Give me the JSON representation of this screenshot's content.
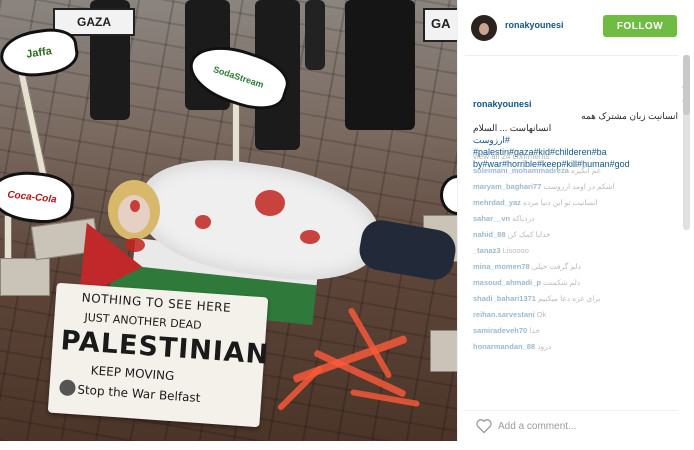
{
  "post": {
    "username": "ronakyounesi",
    "follow_label": "FOLLOW",
    "watermark_text": "mashreghnews.ir",
    "caption": {
      "user": "ronakyounesi",
      "text_fa_1": "انسانیت زبان مشترک همه",
      "text_fa_2": "انسانهاست ... السلام",
      "hashtags_line1": "#ارزوست",
      "hashtags_line2": "#palestin#gaza#kid#childeren#ba",
      "hashtags_line3": "by#war#horrible#keep#kill#human#god"
    },
    "view_all": "view all 24 comments",
    "comments": [
      {
        "user": "soleimani_mohammadreza",
        "text": "غم انگیزه"
      },
      {
        "user": "maryam_baghari77",
        "text": "اشکم در اومد ارزوست"
      },
      {
        "user": "mehrdad_yaz",
        "text": "انسانیت تو این دنیا مرده"
      },
      {
        "user": "sahar__vn",
        "text": "دردناکه"
      },
      {
        "user": "nahid_88",
        "text": "خدایا کمک کن"
      },
      {
        "user": "_tanaz3",
        "text": "Lisoooo"
      },
      {
        "user": "mina_momen78",
        "text": "دلم گرفت خیلی"
      },
      {
        "user": "masoud_ahmadi_p",
        "text": "دلم شکست"
      },
      {
        "user": "shadi_bahari1371",
        "text": "برای غزه دعا میکنیم"
      },
      {
        "user": "reihan.sarvestani",
        "text": "Ok"
      },
      {
        "user": "samiradeveh70",
        "text": "خدا"
      },
      {
        "user": "honarmandan_88",
        "text": "درود"
      }
    ],
    "add_comment_placeholder": "Add a comment..."
  },
  "photo": {
    "sign_gaza_left": "GAZA",
    "sign_gaza_right": "GA",
    "fish_jaffa": "Jaffa",
    "fish_sodastream": "SodaStream",
    "fish_cocacola": "Coca-Cola",
    "protest_sign": {
      "line1": "NOTHING TO SEE HERE",
      "line2": "JUST ANOTHER DEAD",
      "line3": "PALESTINIAN",
      "line4": "KEEP MOVING",
      "line5": "Stop the War Belfast"
    }
  },
  "colors": {
    "follow_green": "#6ebd42",
    "link_blue": "#125688",
    "blood_red": "#c2241f",
    "flag_green": "#2f7a3a",
    "flag_red": "#c0282a"
  },
  "icons": {
    "heart": "heart-outline-icon",
    "avatar": "profile-avatar"
  }
}
